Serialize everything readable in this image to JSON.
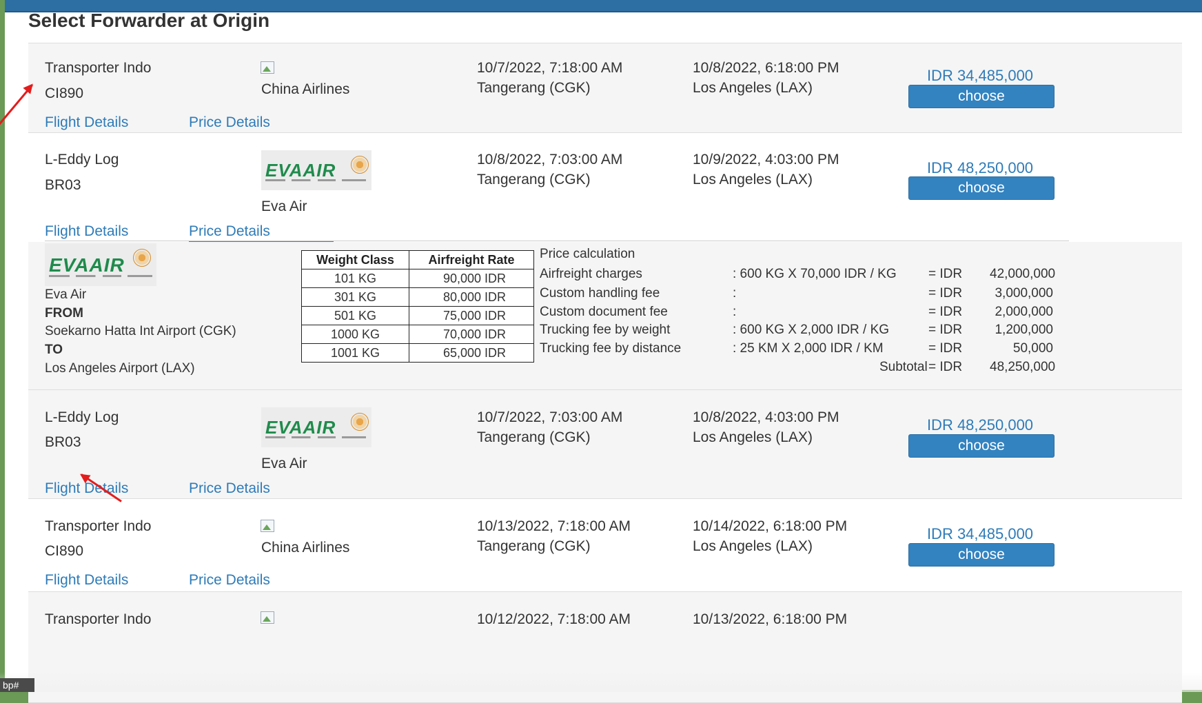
{
  "page": {
    "title": "Select Forwarder at Origin"
  },
  "offers": [
    {
      "forwarder": "Transporter Indo",
      "code": "CI890",
      "airline": "China Airlines",
      "logo": "broken-image-icon",
      "depart_datetime": "10/7/2022, 7:18:00 AM",
      "depart_place": "Tangerang (CGK)",
      "arrive_datetime": "10/8/2022, 6:18:00 PM",
      "arrive_place": "Los Angeles (LAX)",
      "price": "IDR 34,485,000",
      "choose_label": "choose",
      "flight_details": "Flight Details",
      "price_details": "Price Details"
    },
    {
      "forwarder": "L-Eddy Log",
      "code": "BR03",
      "airline": "Eva Air",
      "logo": "eva-air-logo",
      "depart_datetime": "10/8/2022, 7:03:00 AM",
      "depart_place": "Tangerang (CGK)",
      "arrive_datetime": "10/9/2022, 4:03:00 PM",
      "arrive_place": "Los Angeles (LAX)",
      "price": "IDR 48,250,000",
      "choose_label": "choose",
      "flight_details": "Flight Details",
      "price_details": "Price Details"
    },
    {
      "forwarder": "L-Eddy Log",
      "code": "BR03",
      "airline": "Eva Air",
      "logo": "eva-air-logo",
      "depart_datetime": "10/7/2022, 7:03:00 AM",
      "depart_place": "Tangerang (CGK)",
      "arrive_datetime": "10/8/2022, 4:03:00 PM",
      "arrive_place": "Los Angeles (LAX)",
      "price": "IDR 48,250,000",
      "choose_label": "choose",
      "flight_details": "Flight Details",
      "price_details": "Price Details"
    },
    {
      "forwarder": "Transporter Indo",
      "code": "CI890",
      "airline": "China Airlines",
      "logo": "broken-image-icon",
      "depart_datetime": "10/13/2022, 7:18:00 AM",
      "depart_place": "Tangerang (CGK)",
      "arrive_datetime": "10/14/2022, 6:18:00 PM",
      "arrive_place": "Los Angeles (LAX)",
      "price": "IDR 34,485,000",
      "choose_label": "choose",
      "flight_details": "Flight Details",
      "price_details": "Price Details"
    },
    {
      "forwarder": "Transporter Indo",
      "depart_datetime": "10/12/2022, 7:18:00 AM",
      "arrive_datetime": "10/13/2022, 6:18:00 PM"
    }
  ],
  "price_details": {
    "logo_text": "EVAAIR",
    "airline": "Eva Air",
    "from_label": "FROM",
    "from": "Soekarno Hatta Int Airport (CGK)",
    "to_label": "TO",
    "to": "Los Angeles Airport (LAX)",
    "rate_table": {
      "headers": [
        "Weight Class",
        "Airfreight Rate"
      ],
      "rows": [
        [
          "101 KG",
          "90,000 IDR"
        ],
        [
          "301 KG",
          "80,000 IDR"
        ],
        [
          "501 KG",
          "75,000 IDR"
        ],
        [
          "1000 KG",
          "70,000 IDR"
        ],
        [
          "1001 KG",
          "65,000 IDR"
        ]
      ]
    },
    "calc_title": "Price calculation",
    "lines": [
      {
        "label": "Airfreight charges",
        "detail": ": 600 KG X 70,000 IDR / KG",
        "eq": "= IDR",
        "amount": "42,000,000"
      },
      {
        "label": "Custom handling fee",
        "detail": ":",
        "eq": "= IDR",
        "amount": "3,000,000"
      },
      {
        "label": "Custom document fee",
        "detail": ":",
        "eq": "= IDR",
        "amount": "2,000,000"
      },
      {
        "label": "Trucking fee by weight",
        "detail": ": 600 KG X 2,000 IDR / KG",
        "eq": "= IDR",
        "amount": "1,200,000"
      },
      {
        "label": "Trucking fee by distance",
        "detail": ": 25 KM X 2,000 IDR / KM",
        "eq": "= IDR",
        "amount": "50,000"
      }
    ],
    "subtotal": {
      "label": "Subtotal",
      "eq": "= IDR",
      "amount": "48,250,000"
    }
  },
  "status_badge": "bp#",
  "colors": {
    "accent": "#3383c0",
    "link": "#2e7bb8",
    "topbar": "#2e6fa3",
    "annotation": "#e41c1c",
    "eva_green": "#1f8b4c"
  }
}
